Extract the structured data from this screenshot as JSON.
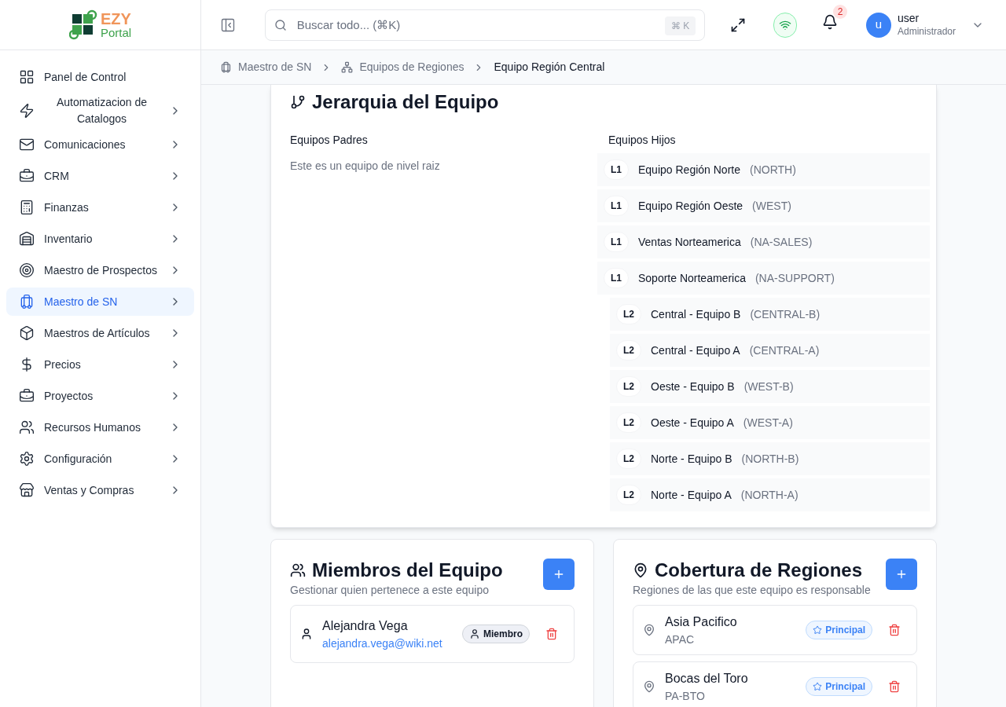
{
  "logo": {
    "line1": "EZY",
    "line2": "Portal"
  },
  "sidebar": {
    "items": [
      {
        "label": "Panel de Control",
        "has_submenu": false,
        "selected": false
      },
      {
        "label": "Automatizacion de Catalogos",
        "has_submenu": true,
        "selected": false
      },
      {
        "label": "Comunicaciones",
        "has_submenu": true,
        "selected": false
      },
      {
        "label": "CRM",
        "has_submenu": true,
        "selected": false
      },
      {
        "label": "Finanzas",
        "has_submenu": true,
        "selected": false
      },
      {
        "label": "Inventario",
        "has_submenu": true,
        "selected": false
      },
      {
        "label": "Maestro de Prospectos",
        "has_submenu": true,
        "selected": false
      },
      {
        "label": "Maestro de SN",
        "has_submenu": true,
        "selected": true
      },
      {
        "label": "Maestros de Artículos",
        "has_submenu": true,
        "selected": false
      },
      {
        "label": "Precios",
        "has_submenu": true,
        "selected": false
      },
      {
        "label": "Proyectos",
        "has_submenu": true,
        "selected": false
      },
      {
        "label": "Recursos Humanos",
        "has_submenu": true,
        "selected": false
      },
      {
        "label": "Configuración",
        "has_submenu": true,
        "selected": false
      },
      {
        "label": "Ventas y Compras",
        "has_submenu": true,
        "selected": false
      }
    ]
  },
  "header": {
    "search": {
      "placeholder": "Buscar todo... (⌘K)",
      "shortcut": "⌘ K"
    },
    "notifications": "2",
    "user": {
      "initial": "u",
      "name": "user",
      "role": "Administrador"
    }
  },
  "breadcrumb": [
    {
      "label": "Maestro de SN"
    },
    {
      "label": "Equipos de Regiones"
    },
    {
      "label": "Equipo Región Central"
    }
  ],
  "hierarchy": {
    "title": "Jerarquia del Equipo",
    "parents": {
      "heading": "Equipos Padres",
      "empty_text": "Este es un equipo de nivel raiz"
    },
    "children": {
      "heading": "Equipos Hijos",
      "items": [
        {
          "level": "L1",
          "kind": "top",
          "name": "Equipo Región Norte",
          "code": "(NORTH)"
        },
        {
          "level": "L1",
          "kind": "top",
          "name": "Equipo Región Oeste",
          "code": "(WEST)"
        },
        {
          "level": "L1",
          "kind": "top",
          "name": "Ventas Norteamerica",
          "code": "(NA-SALES)"
        },
        {
          "level": "L1",
          "kind": "top",
          "name": "Soporte Norteamerica",
          "code": "(NA-SUPPORT)"
        },
        {
          "level": "L2",
          "kind": "sub",
          "name": "Central - Equipo B",
          "code": "(CENTRAL-B)"
        },
        {
          "level": "L2",
          "kind": "sub",
          "name": "Central - Equipo A",
          "code": "(CENTRAL-A)"
        },
        {
          "level": "L2",
          "kind": "sub",
          "name": "Oeste - Equipo B",
          "code": "(WEST-B)"
        },
        {
          "level": "L2",
          "kind": "sub",
          "name": "Oeste - Equipo A",
          "code": "(WEST-A)"
        },
        {
          "level": "L2",
          "kind": "sub",
          "name": "Norte - Equipo B",
          "code": "(NORTH-B)"
        },
        {
          "level": "L2",
          "kind": "sub",
          "name": "Norte - Equipo A",
          "code": "(NORTH-A)"
        }
      ]
    }
  },
  "members": {
    "title": "Miembros del Equipo",
    "subtitle": "Gestionar quien pertenece a este equipo",
    "items": [
      {
        "name": "Alejandra Vega",
        "email": "alejandra.vega@wiki.net",
        "role": "Miembro"
      }
    ]
  },
  "regions": {
    "title": "Cobertura de Regiones",
    "subtitle": "Regiones de las que este equipo es responsable",
    "items": [
      {
        "name": "Asia Pacifico",
        "code": "APAC",
        "badge": "Principal"
      },
      {
        "name": "Bocas del Toro",
        "code": "PA-BTO",
        "badge": "Principal"
      }
    ]
  }
}
